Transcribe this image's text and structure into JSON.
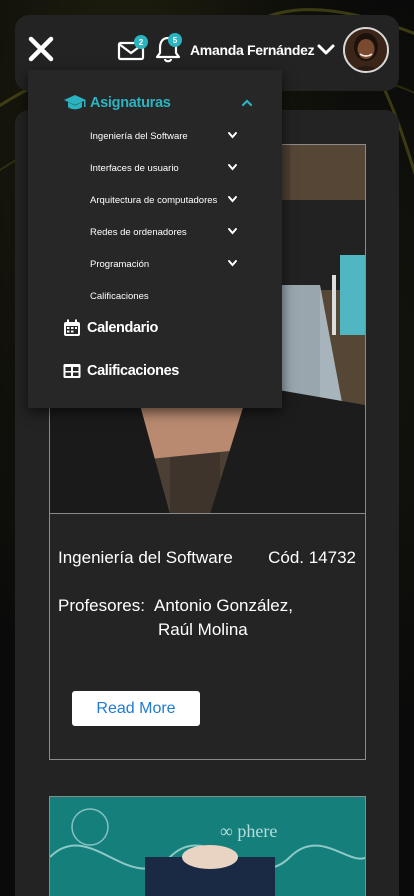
{
  "header": {
    "mail_badge": "2",
    "notifications_badge": "5",
    "user_name": "Amanda Fernández",
    "icons": [
      "close-icon",
      "mail-icon",
      "bell-icon",
      "chevron-down-icon",
      "avatar"
    ]
  },
  "menu": {
    "section_label": "Asignaturas",
    "section_icon": "graduation-cap-icon",
    "sub_items": [
      {
        "label": "Ingeniería del Software",
        "has_chevron": true
      },
      {
        "label": "Interfaces de usuario",
        "has_chevron": true
      },
      {
        "label": "Arquitectura de computadores",
        "has_chevron": true
      },
      {
        "label": "Redes de ordenadores",
        "has_chevron": true
      },
      {
        "label": "Programación",
        "has_chevron": true
      },
      {
        "label": "Calificaciones",
        "has_chevron": false
      }
    ],
    "main_items": [
      {
        "label": "Calendario",
        "icon": "calendar-icon"
      },
      {
        "label": "Calificaciones",
        "icon": "grid-table-icon"
      }
    ]
  },
  "card": {
    "title": "Ingeniería del Software",
    "code": "Cód. 14732",
    "professors_label": "Profesores:",
    "professor_1": "Antonio González,",
    "professor_2": "Raúl Molina",
    "read_more": "Read More"
  },
  "colors": {
    "accent": "#2bb3c0",
    "panel": "#232323",
    "menu": "#272727",
    "link": "#1f7bd1"
  }
}
